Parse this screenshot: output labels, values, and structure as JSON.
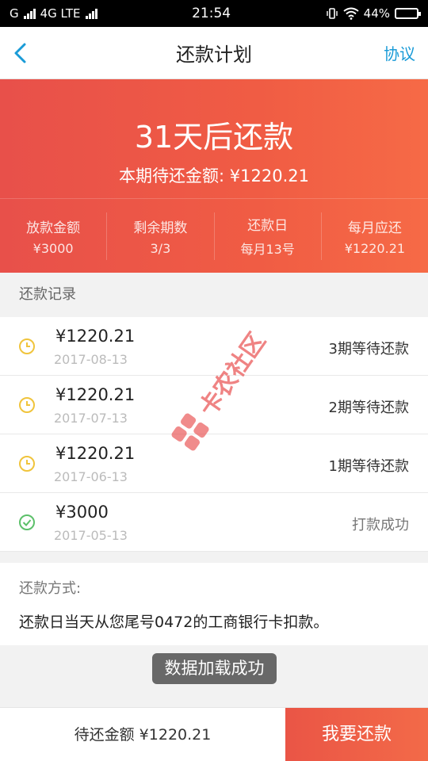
{
  "status_bar": {
    "carrier": "G",
    "network": "4G LTE",
    "time": "21:54",
    "battery": "44%",
    "battery_level": 0.44
  },
  "nav": {
    "title": "还款计划",
    "agreement": "协议"
  },
  "hero": {
    "countdown": "31天后还款",
    "due_amount": "本期待还金额: ¥1220.21",
    "stats": [
      {
        "label": "放款金额",
        "value": "¥3000"
      },
      {
        "label": "剩余期数",
        "value": "3/3"
      },
      {
        "label": "还款日",
        "value": "每月13号"
      },
      {
        "label": "每月应还",
        "value": "¥1220.21"
      }
    ]
  },
  "records_title": "还款记录",
  "records": [
    {
      "amount": "¥1220.21",
      "date": "2017-08-13",
      "status": "3期等待还款",
      "icon": "clock-icon"
    },
    {
      "amount": "¥1220.21",
      "date": "2017-07-13",
      "status": "2期等待还款",
      "icon": "clock-icon"
    },
    {
      "amount": "¥1220.21",
      "date": "2017-06-13",
      "status": "1期等待还款",
      "icon": "clock-icon"
    },
    {
      "amount": "¥3000",
      "date": "2017-05-13",
      "status": "打款成功",
      "icon": "check-circle-icon"
    }
  ],
  "method": {
    "label": "还款方式:",
    "text": "还款日当天从您尾号0472的工商银行卡扣款。"
  },
  "toast": "数据加载成功",
  "bottom": {
    "pending": "待还金额 ¥1220.21",
    "pay_button": "我要还款"
  },
  "watermark_text": "卡农社区",
  "colors": {
    "accent": "#1a9bd7",
    "hero_red": "#ee5848",
    "clock_yellow": "#f0c43c",
    "success_green": "#5cc06a"
  }
}
